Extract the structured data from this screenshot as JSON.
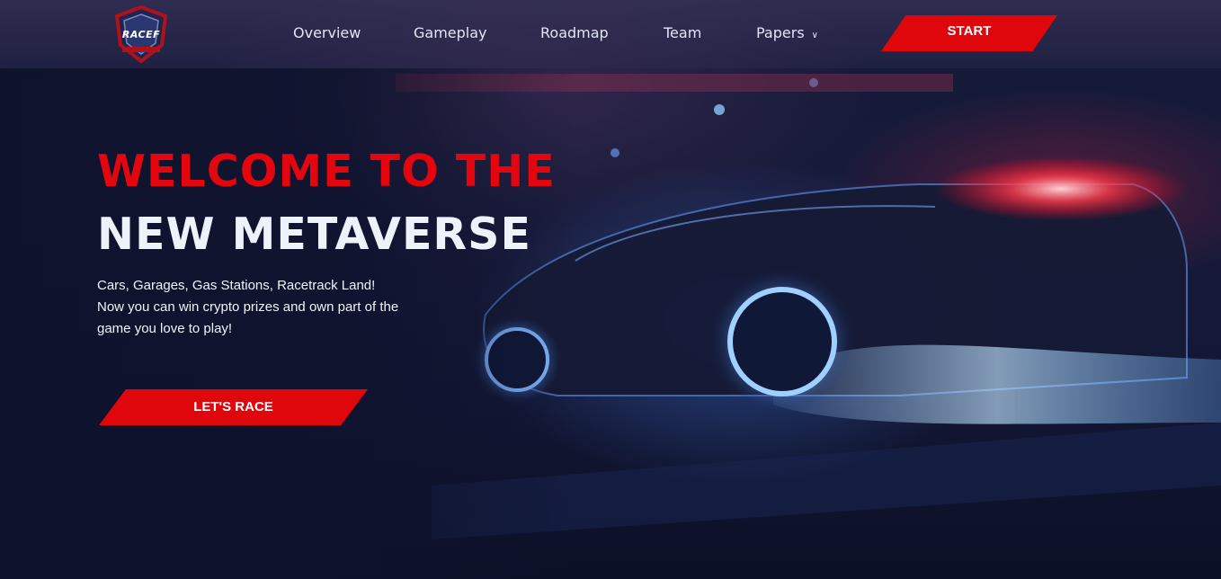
{
  "brand": {
    "logo_text": "RACEF",
    "logo_icon": "shield-icon"
  },
  "nav": {
    "items": [
      {
        "label": "Overview"
      },
      {
        "label": "Gameplay"
      },
      {
        "label": "Roadmap"
      },
      {
        "label": "Team"
      },
      {
        "label": "Papers",
        "icon": "chevron-down-icon"
      }
    ],
    "start_label": "START"
  },
  "hero": {
    "line1": "WELCOME TO THE",
    "line2": "NEW METAVERSE",
    "copy": [
      "Cars, Garages, Gas Stations, Racetrack Land!",
      "Now you can win crypto prizes and own part of the",
      "game you love to play!"
    ],
    "cta_label": "LET'S RACE"
  },
  "colors": {
    "accent": "#e0070c",
    "background": "#0d1228",
    "text_light": "#eef2fb"
  }
}
